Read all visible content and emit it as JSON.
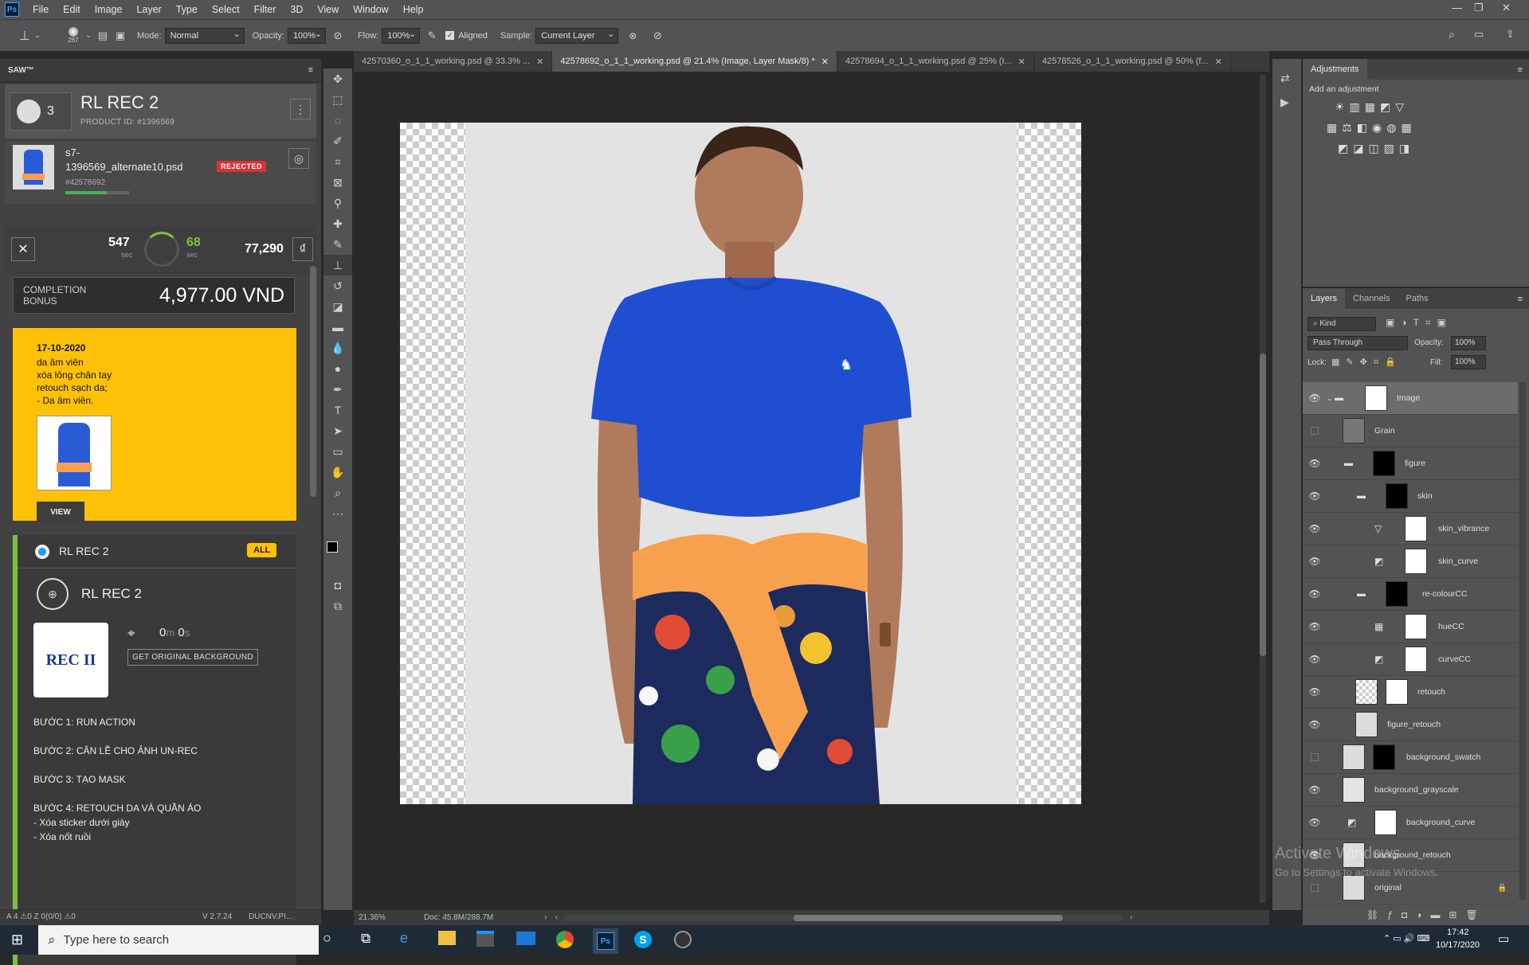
{
  "menubar": {
    "items": [
      "File",
      "Edit",
      "Image",
      "Layer",
      "Type",
      "Select",
      "Filter",
      "3D",
      "View",
      "Window",
      "Help"
    ],
    "logo": "Ps"
  },
  "options": {
    "brush_size": "267",
    "mode_label": "Mode:",
    "mode_value": "Normal",
    "opacity_label": "Opacity:",
    "opacity_value": "100%",
    "flow_label": "Flow:",
    "flow_value": "100%",
    "aligned_label": "Aligned",
    "sample_label": "Sample:",
    "sample_value": "Current Layer"
  },
  "saw": {
    "title": "SAW™",
    "job_count": "3",
    "job_title": "RL REC 2",
    "product_id": "PRODUCT ID: #1396569",
    "file_name_line1": "s7-",
    "file_name_line2": "1396569_alternate10.psd",
    "status_badge": "REJECTED",
    "file_id": "#42578692",
    "progress": 0.65,
    "time_total": "547",
    "time_total_unit": "sec",
    "time_elapsed": "68",
    "time_elapsed_unit": "sec",
    "points": "77,290",
    "currency_symbol": "₫",
    "bonus_label_1": "COMPLETION",
    "bonus_label_2": "BONUS",
    "bonus_value": "4,977.00 VND",
    "note": {
      "date": "17-10-2020",
      "lines": [
        "da âm viên",
        "xóa lông chân tay",
        "retouch sạch da;",
        "- Da âm viên."
      ],
      "view_button": "VIEW"
    },
    "section_title": "RL REC 2",
    "section_badge": "ALL",
    "action_title": "RL REC 2",
    "timer_value": "0",
    "timer_m": "m",
    "timer_sec_value": "0",
    "timer_s": "s",
    "get_bg_button": "GET ORIGINAL BACKGROUND",
    "logo_text": "REC II",
    "steps": [
      "BƯỚC 1: RUN ACTION",
      "BƯỚC 2: CĂN LỀ CHO ẢNH UN-REC",
      "BƯỚC 3: TẠO MASK",
      "BƯỚC 4: RETOUCH DA VÀ QUẦN ÁO"
    ],
    "substeps": [
      "- Xóa sticker dưới giày",
      "- Xóa nốt ruồi"
    ],
    "footer_left": "A 4   ⚠0   Z 0(0/0)   ⚠0",
    "footer_version": "V 2.7.24",
    "footer_user": "DUCNV.PI..."
  },
  "tabs": [
    {
      "label": "42570360_o_1_1_working.psd @ 33.3% ...",
      "active": false
    },
    {
      "label": "42578692_o_1_1_working.psd @ 21.4% (Image, Layer Mask/8) *",
      "active": true
    },
    {
      "label": "42578694_o_1_1_working.psd @ 25% (I...",
      "active": false
    },
    {
      "label": "42578526_o_1_1_working.psd @ 50% (f...",
      "active": false
    }
  ],
  "status": {
    "zoom": "21.36%",
    "doc": "Doc: 45.8M/288.7M"
  },
  "adjustments": {
    "title": "Adjustments",
    "subtitle": "Add an adjustment"
  },
  "layers": {
    "tabs": [
      "Layers",
      "Channels",
      "Paths"
    ],
    "filter_value": "Kind",
    "blend_value": "Pass Through",
    "opacity_label": "Opacity:",
    "opacity_value": "100%",
    "lock_label": "Lock:",
    "fill_label": "Fill:",
    "fill_value": "100%",
    "items": [
      {
        "name": "Image",
        "visible": true,
        "selected": true
      },
      {
        "name": "Grain",
        "visible": false,
        "selected": false
      },
      {
        "name": "figure",
        "visible": true,
        "selected": false
      },
      {
        "name": "skin",
        "visible": true,
        "selected": false
      },
      {
        "name": "skin_vibrance",
        "visible": true,
        "selected": false
      },
      {
        "name": "skin_curve",
        "visible": true,
        "selected": false
      },
      {
        "name": "re-colourCC",
        "visible": true,
        "selected": false
      },
      {
        "name": "hueCC",
        "visible": true,
        "selected": false
      },
      {
        "name": "curveCC",
        "visible": true,
        "selected": false
      },
      {
        "name": "retouch",
        "visible": true,
        "selected": false
      },
      {
        "name": "figure_retouch",
        "visible": true,
        "selected": false
      },
      {
        "name": "background_swatch",
        "visible": false,
        "selected": false
      },
      {
        "name": "background_grayscale",
        "visible": true,
        "selected": false
      },
      {
        "name": "background_curve",
        "visible": true,
        "selected": false
      },
      {
        "name": "background_retouch",
        "visible": true,
        "selected": false
      },
      {
        "name": "original",
        "visible": false,
        "selected": false
      }
    ]
  },
  "watermark": {
    "line1": "Activate Windows",
    "line2": "Go to Settings to activate Windows."
  },
  "taskbar": {
    "search_placeholder": "Type here to search",
    "time": "17:42",
    "date": "10/17/2020"
  }
}
